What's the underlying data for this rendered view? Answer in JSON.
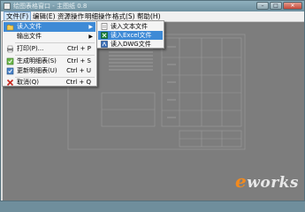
{
  "window": {
    "title": "绘图表格窗口 - 主图纸 0.8",
    "controls": {
      "minimize": "–",
      "maximize": "□",
      "close": "✕"
    }
  },
  "menubar": [
    {
      "label": "文件(F)"
    },
    {
      "label": "编辑(E)"
    },
    {
      "label": "资源操作"
    },
    {
      "label": "明细操作"
    },
    {
      "label": "格式(S)"
    },
    {
      "label": "帮助(H)"
    }
  ],
  "file_menu": [
    {
      "label": "读入文件",
      "icon": "folder-icon",
      "has_submenu": true
    },
    {
      "label": "输出文件",
      "icon": "",
      "has_submenu": true
    },
    {
      "label": "打印(P)...",
      "icon": "printer-icon",
      "shortcut": "Ctrl + P"
    },
    {
      "label": "生成明细表(S)",
      "icon": "generate-icon",
      "shortcut": "Ctrl + S"
    },
    {
      "label": "更新明细表(U)",
      "icon": "update-icon",
      "shortcut": "Ctrl + U"
    },
    {
      "label": "取消(Q)",
      "icon": "cancel-icon",
      "shortcut": "Ctrl + Q"
    }
  ],
  "submenu": [
    {
      "label": "读入文本文件",
      "icon": "text-file-icon"
    },
    {
      "label": "读入Excel文件",
      "icon": "excel-icon"
    },
    {
      "label": "读入DWG文件",
      "icon": "dwg-icon"
    }
  ],
  "watermark": {
    "e": "e",
    "rest": "works"
  },
  "colors": {
    "highlight": "#3e8ad6",
    "canvas": "#7d7d7d",
    "logo": "#f28a1e"
  }
}
